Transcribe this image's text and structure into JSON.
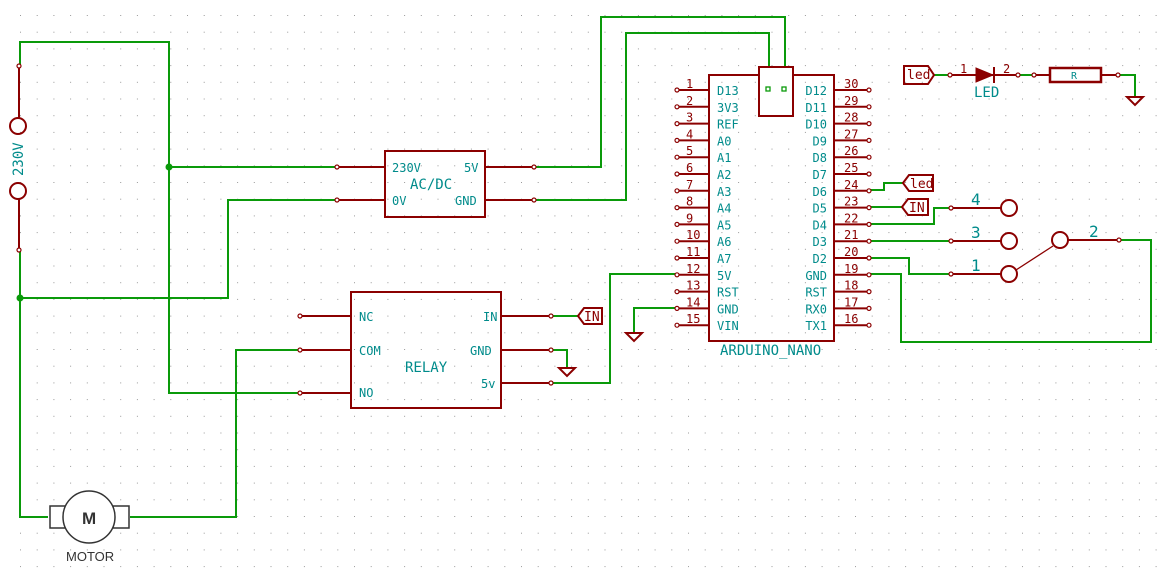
{
  "power_source": {
    "label": "230V"
  },
  "acdc": {
    "title": "AC/DC",
    "pins": {
      "in_l": "230V",
      "in_n": "0V",
      "out_p": "5V",
      "out_g": "GND"
    }
  },
  "relay": {
    "title": "RELAY",
    "left_pins": [
      "NC",
      "COM",
      "NO"
    ],
    "right_pins": [
      "IN",
      "GND",
      "5v"
    ]
  },
  "arduino": {
    "title": "ARDUINO_NANO",
    "left_pins": [
      {
        "num": "1",
        "name": "D13"
      },
      {
        "num": "2",
        "name": "3V3"
      },
      {
        "num": "3",
        "name": "REF"
      },
      {
        "num": "4",
        "name": "A0"
      },
      {
        "num": "5",
        "name": "A1"
      },
      {
        "num": "6",
        "name": "A2"
      },
      {
        "num": "7",
        "name": "A3"
      },
      {
        "num": "8",
        "name": "A4"
      },
      {
        "num": "9",
        "name": "A5"
      },
      {
        "num": "10",
        "name": "A6"
      },
      {
        "num": "11",
        "name": "A7"
      },
      {
        "num": "12",
        "name": "5V"
      },
      {
        "num": "13",
        "name": "RST"
      },
      {
        "num": "14",
        "name": "GND"
      },
      {
        "num": "15",
        "name": "VIN"
      }
    ],
    "right_pins": [
      {
        "num": "30",
        "name": "D12"
      },
      {
        "num": "29",
        "name": "D11"
      },
      {
        "num": "28",
        "name": "D10"
      },
      {
        "num": "27",
        "name": "D9"
      },
      {
        "num": "26",
        "name": "D8"
      },
      {
        "num": "25",
        "name": "D7"
      },
      {
        "num": "24",
        "name": "D6"
      },
      {
        "num": "23",
        "name": "D5"
      },
      {
        "num": "22",
        "name": "D4"
      },
      {
        "num": "21",
        "name": "D3"
      },
      {
        "num": "20",
        "name": "D2"
      },
      {
        "num": "19",
        "name": "GND"
      },
      {
        "num": "18",
        "name": "RST"
      },
      {
        "num": "17",
        "name": "RX0"
      },
      {
        "num": "16",
        "name": "TX1"
      }
    ]
  },
  "labels": {
    "led": "led",
    "in": "IN"
  },
  "led": {
    "label": "LED",
    "pin1": "1",
    "pin2": "2"
  },
  "resistor": {
    "label": "R"
  },
  "switch": {
    "positions": [
      "4",
      "3",
      "1"
    ],
    "common": "2"
  },
  "motor": {
    "symbol": "M",
    "label": "MOTOR"
  }
}
